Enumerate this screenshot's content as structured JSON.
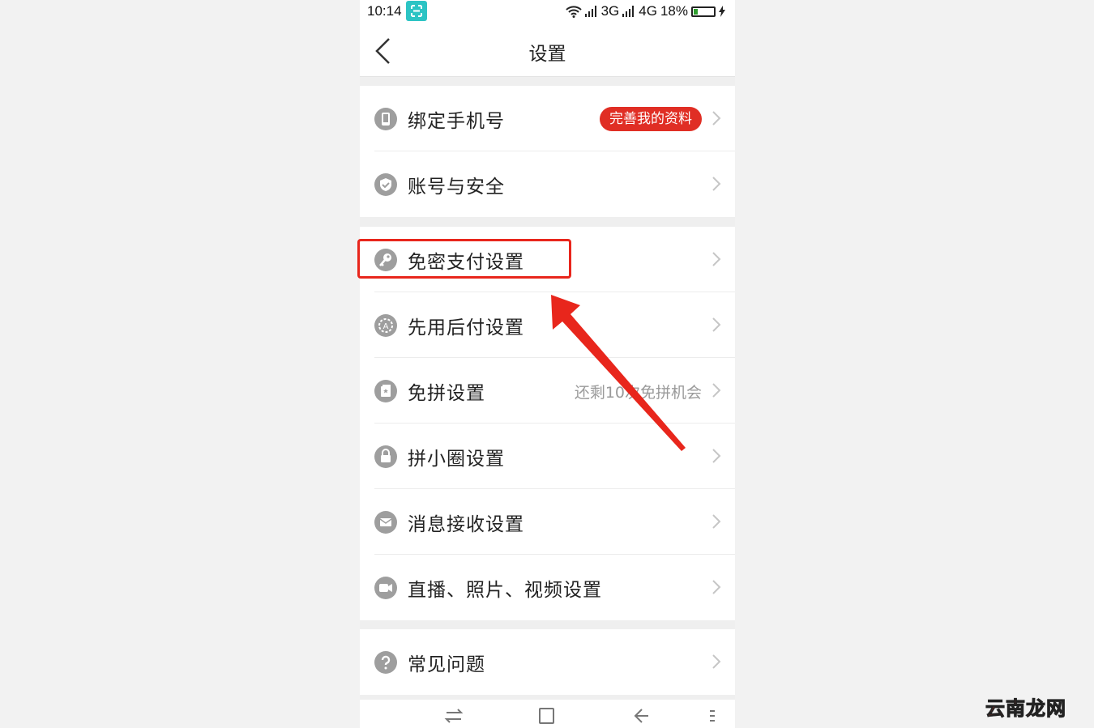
{
  "status_bar": {
    "time": "10:14",
    "network1": "3G",
    "network2": "4G",
    "battery": "18%",
    "battery_level": 0.18
  },
  "header": {
    "title": "设置"
  },
  "group1": [
    {
      "label": "绑定手机号",
      "badge": "完善我的资料"
    },
    {
      "label": "账号与安全"
    }
  ],
  "group2": [
    {
      "label": "免密支付设置"
    },
    {
      "label": "先用后付设置"
    },
    {
      "label": "免拼设置",
      "extra": "还剩10次免拼机会"
    },
    {
      "label": "拼小圈设置"
    },
    {
      "label": "消息接收设置"
    },
    {
      "label": "直播、照片、视频设置"
    }
  ],
  "group3": [
    {
      "label": "常见问题"
    }
  ],
  "icons": {
    "phone": "phone-icon",
    "shield": "shield-icon",
    "key": "key-icon",
    "gear": "gear-badge-icon",
    "card": "card-icon",
    "lock": "lock-icon",
    "mail": "mail-icon",
    "camera": "video-camera-icon",
    "help": "question-icon"
  },
  "colors": {
    "accent": "#e02e24",
    "icon_gray": "#9e9e9e",
    "annotation": "#e8261c"
  },
  "watermark": "云南龙网"
}
